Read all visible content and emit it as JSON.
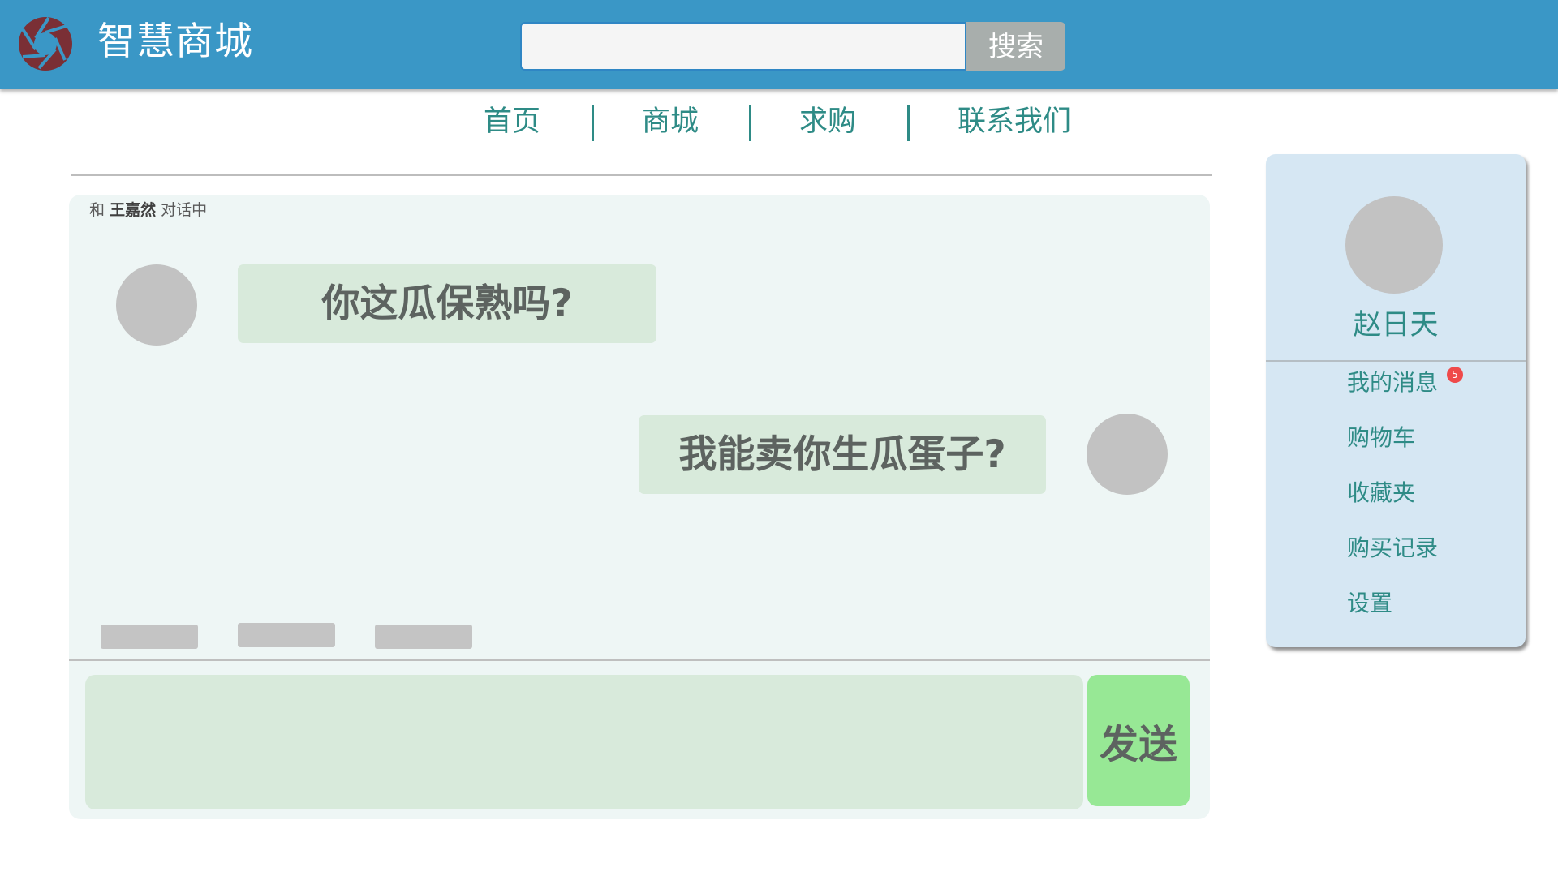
{
  "header": {
    "app_title": "智慧商城",
    "logo_icon": "aperture-logo-icon",
    "search": {
      "value": "",
      "placeholder": "",
      "button_label": "搜索"
    }
  },
  "nav": {
    "items": [
      {
        "label": "首页"
      },
      {
        "label": "商城"
      },
      {
        "label": "求购"
      },
      {
        "label": "联系我们"
      }
    ],
    "separator": "|"
  },
  "chat": {
    "header_prefix": "和",
    "partner_name": "王嘉然",
    "header_suffix": "对话中",
    "messages": [
      {
        "side": "left",
        "text": "你这瓜保熟吗?"
      },
      {
        "side": "right",
        "text": "我能卖你生瓜蛋子?"
      }
    ],
    "quick_actions_count": 3,
    "input": {
      "value": "",
      "placeholder": ""
    },
    "send_label": "发送"
  },
  "user": {
    "name": "赵日天",
    "menu": [
      {
        "label": "我的消息",
        "badge": "5"
      },
      {
        "label": "购物车"
      },
      {
        "label": "收藏夹"
      },
      {
        "label": "购买记录"
      },
      {
        "label": "设置"
      }
    ]
  },
  "colors": {
    "header_bg": "#3a97c6",
    "accent_text": "#2e8b86",
    "chat_bg": "#eef6f5",
    "bubble_bg": "#d8eadb",
    "send_bg": "#97e895",
    "user_card_bg": "#d6e7f3",
    "badge_bg": "#ef4a4a"
  }
}
